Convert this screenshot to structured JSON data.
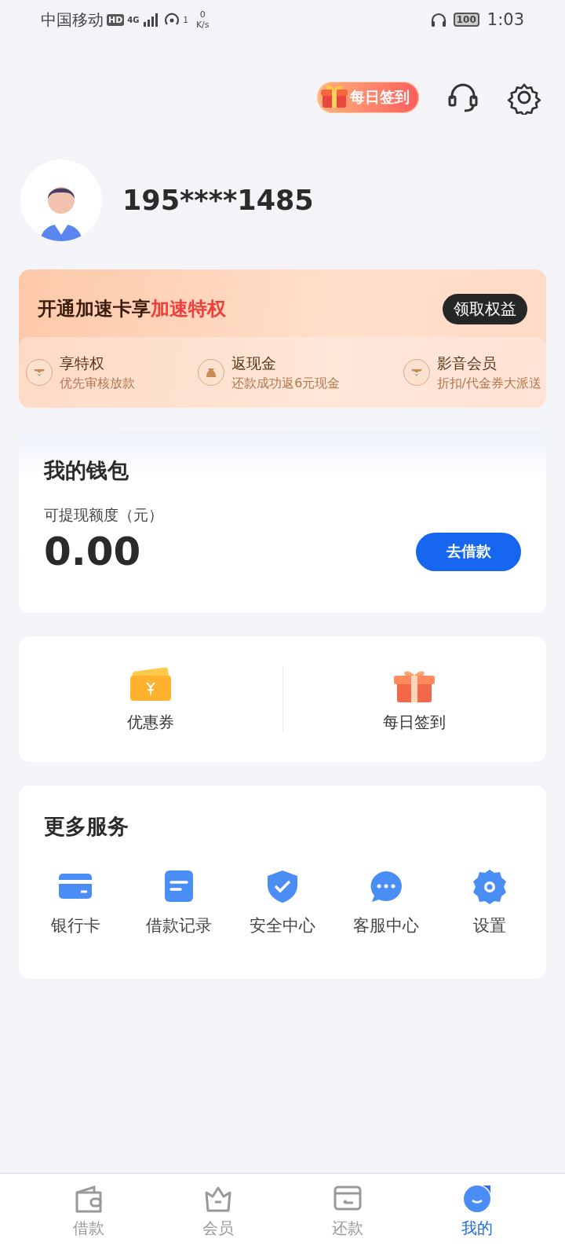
{
  "status_bar": {
    "carrier": "中国移动",
    "hd": "HD",
    "network": "4G",
    "hotspot_count": "1",
    "speed_value": "0",
    "speed_unit": "K/s",
    "battery": "100",
    "time": "1:03"
  },
  "header": {
    "checkin": "每日签到"
  },
  "profile": {
    "phone": "195****1485"
  },
  "promo": {
    "title": "开通加速卡享",
    "title_highlight": "加速特权",
    "button": "领取权益",
    "benefits": [
      {
        "title": "享特权",
        "subtitle": "优先审核放款"
      },
      {
        "title": "返现金",
        "subtitle": "还款成功返6元现金"
      },
      {
        "title": "影音会员",
        "subtitle": "折扣/代金券大派送"
      }
    ]
  },
  "wallet": {
    "title": "我的钱包",
    "amount_label": "可提现额度（元）",
    "amount": "0.00",
    "button": "去借款"
  },
  "shortcuts": [
    {
      "label": "优惠券"
    },
    {
      "label": "每日签到"
    }
  ],
  "services": {
    "title": "更多服务",
    "items": [
      {
        "label": "银行卡"
      },
      {
        "label": "借款记录"
      },
      {
        "label": "安全中心"
      },
      {
        "label": "客服中心"
      },
      {
        "label": "设置"
      }
    ]
  },
  "tabs": [
    {
      "label": "借款",
      "selected": false
    },
    {
      "label": "会员",
      "selected": false
    },
    {
      "label": "还款",
      "selected": false
    },
    {
      "label": "我的",
      "selected": true
    }
  ]
}
